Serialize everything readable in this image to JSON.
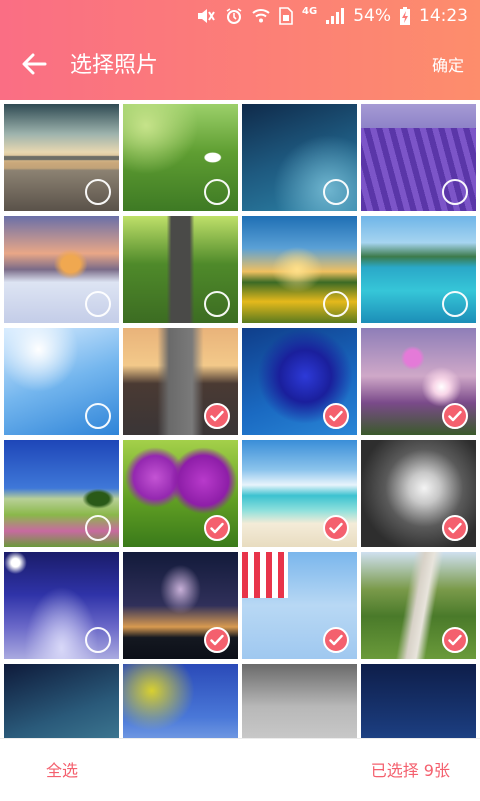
{
  "statusbar": {
    "network": "4G",
    "battery": "54%",
    "time": "14:23",
    "icons": [
      "mute-icon",
      "alarm-icon",
      "wifi-icon",
      "sim-card-icon",
      "signal-icon",
      "battery-charging-icon"
    ]
  },
  "header": {
    "back_icon": "arrow-left-icon",
    "title": "选择照片",
    "confirm_label": "确定"
  },
  "colors": {
    "accent": "#f4606e",
    "header_start": "#fa6e84",
    "header_end": "#fd8d6c"
  },
  "photos": [
    {
      "subject": "pier",
      "selected": false
    },
    {
      "subject": "garden-bench",
      "selected": false
    },
    {
      "subject": "abstract-blue",
      "selected": false
    },
    {
      "subject": "lavender-field",
      "selected": false
    },
    {
      "subject": "snowy-cabin",
      "selected": false
    },
    {
      "subject": "tree-road",
      "selected": false
    },
    {
      "subject": "windmill-sunflowers",
      "selected": false
    },
    {
      "subject": "tropical-bay",
      "selected": false
    },
    {
      "subject": "snowy-branches",
      "selected": false
    },
    {
      "subject": "sunset-road",
      "selected": true
    },
    {
      "subject": "blue-rose",
      "selected": true
    },
    {
      "subject": "cosmos-flowers",
      "selected": true
    },
    {
      "subject": "meadow-tree",
      "selected": false
    },
    {
      "subject": "allium-flowers",
      "selected": true
    },
    {
      "subject": "beach",
      "selected": true
    },
    {
      "subject": "tree-canopy",
      "selected": true
    },
    {
      "subject": "snowy-park-night",
      "selected": false
    },
    {
      "subject": "milky-way",
      "selected": true
    },
    {
      "subject": "hot-air-balloons",
      "selected": true
    },
    {
      "subject": "tree-avenue",
      "selected": true
    },
    {
      "subject": "starry-sky",
      "selected": false
    },
    {
      "subject": "yellow-tree-sky",
      "selected": false
    },
    {
      "subject": "foggy-tree",
      "selected": false
    },
    {
      "subject": "blue-night",
      "selected": false
    }
  ],
  "footer": {
    "select_all_label": "全选",
    "selected_count_label": "已选择 9张"
  }
}
